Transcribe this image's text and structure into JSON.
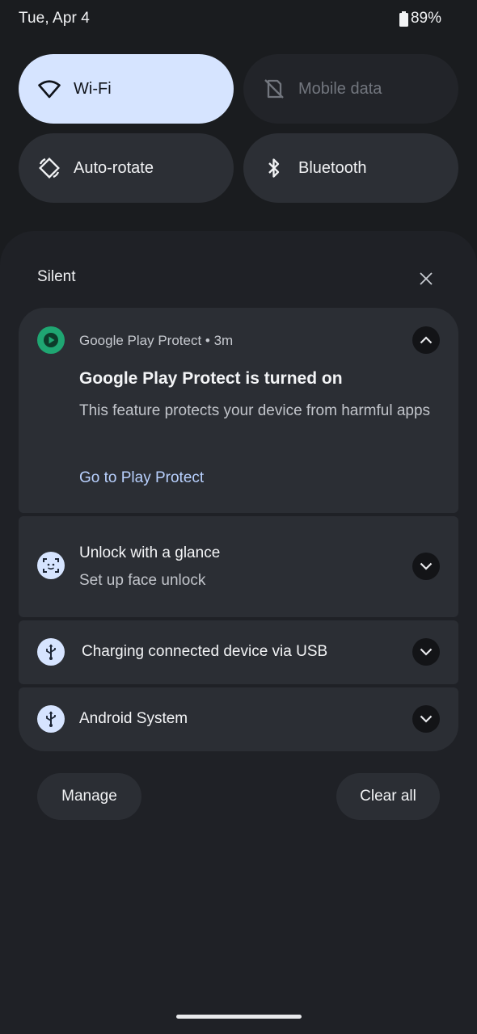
{
  "status_bar": {
    "date": "Tue, Apr 4",
    "battery": "89%"
  },
  "quick_settings": {
    "wifi": {
      "label": "Wi-Fi",
      "icon": "wifi-icon",
      "active": true
    },
    "mobile_data": {
      "label": "Mobile data",
      "icon": "mobile-data-off-icon",
      "active": false
    },
    "auto_rotate": {
      "label": "Auto-rotate",
      "icon": "auto-rotate-icon",
      "active": false
    },
    "bluetooth": {
      "label": "Bluetooth",
      "icon": "bluetooth-icon",
      "active": false
    }
  },
  "notifications": {
    "section_title": "Silent",
    "items": [
      {
        "app": "Google Play Protect",
        "time": "3m",
        "header": "Google Play Protect • 3m",
        "title": "Google Play Protect is turned on",
        "body": "This feature protects your device from harmful apps",
        "action": "Go to Play Protect",
        "icon": "play-protect-icon",
        "expanded": true
      },
      {
        "title": "Unlock with a glance",
        "subtitle": "Set up face unlock",
        "icon": "face-unlock-icon",
        "expanded": false
      },
      {
        "title": "Charging connected device via USB",
        "icon": "usb-icon",
        "expanded": false
      },
      {
        "title": "Android System",
        "icon": "usb-icon",
        "expanded": false
      }
    ]
  },
  "footer": {
    "manage_label": "Manage",
    "clear_all_label": "Clear all"
  },
  "colors": {
    "background": "#1a1c1f",
    "tile_active": "#d6e4ff",
    "card": "#2b2e34",
    "accent_link": "#b9d1ff",
    "play_protect_green": "#1fa672"
  }
}
